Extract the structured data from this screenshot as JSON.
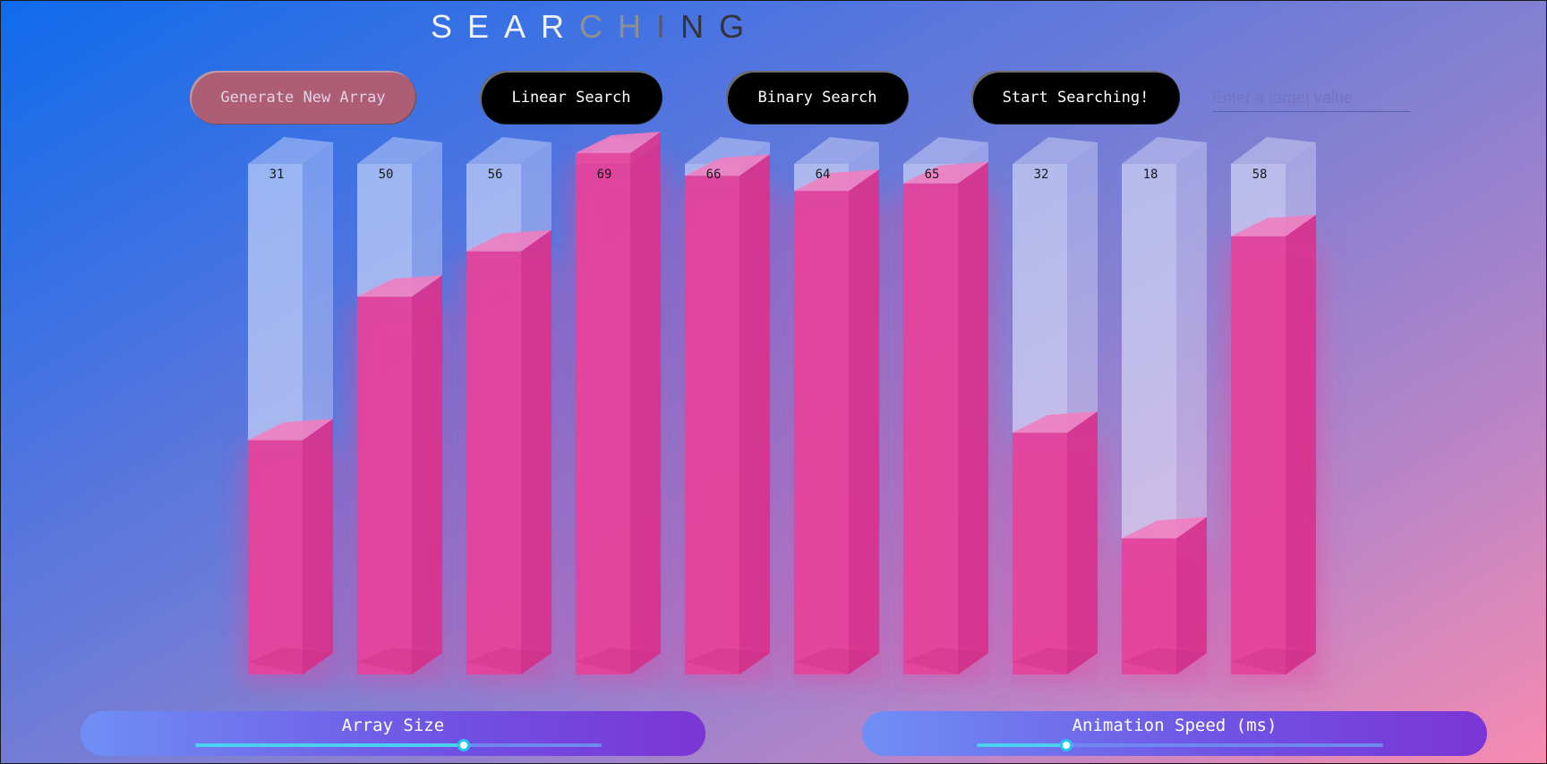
{
  "title": {
    "letters": [
      {
        "char": "S",
        "color": "#f2f2f5"
      },
      {
        "char": "E",
        "color": "#f2f2f5"
      },
      {
        "char": "A",
        "color": "#f2f2f5"
      },
      {
        "char": "R",
        "color": "#f2f2f5"
      },
      {
        "char": "C",
        "color": "#8f8f8f"
      },
      {
        "char": "H",
        "color": "#8f8f8f"
      },
      {
        "char": "I",
        "color": "#5a5a66"
      },
      {
        "char": "N",
        "color": "#333338"
      },
      {
        "char": "G",
        "color": "#333338"
      }
    ]
  },
  "toolbar": {
    "generate_label": "Generate New Array",
    "linear_label": "Linear Search",
    "binary_label": "Binary Search",
    "start_label": "Start Searching!",
    "target_placeholder": "Enter a target value"
  },
  "array": {
    "max_value": 69,
    "values": [
      31,
      50,
      56,
      69,
      66,
      64,
      65,
      32,
      18,
      58
    ],
    "fill_color": "#e6439b",
    "empty_color": "#e8ecff"
  },
  "controls": {
    "array_size": {
      "label": "Array Size",
      "level": 0.66
    },
    "animation_speed": {
      "label": "Animation Speed (ms)",
      "level": 0.22
    }
  }
}
